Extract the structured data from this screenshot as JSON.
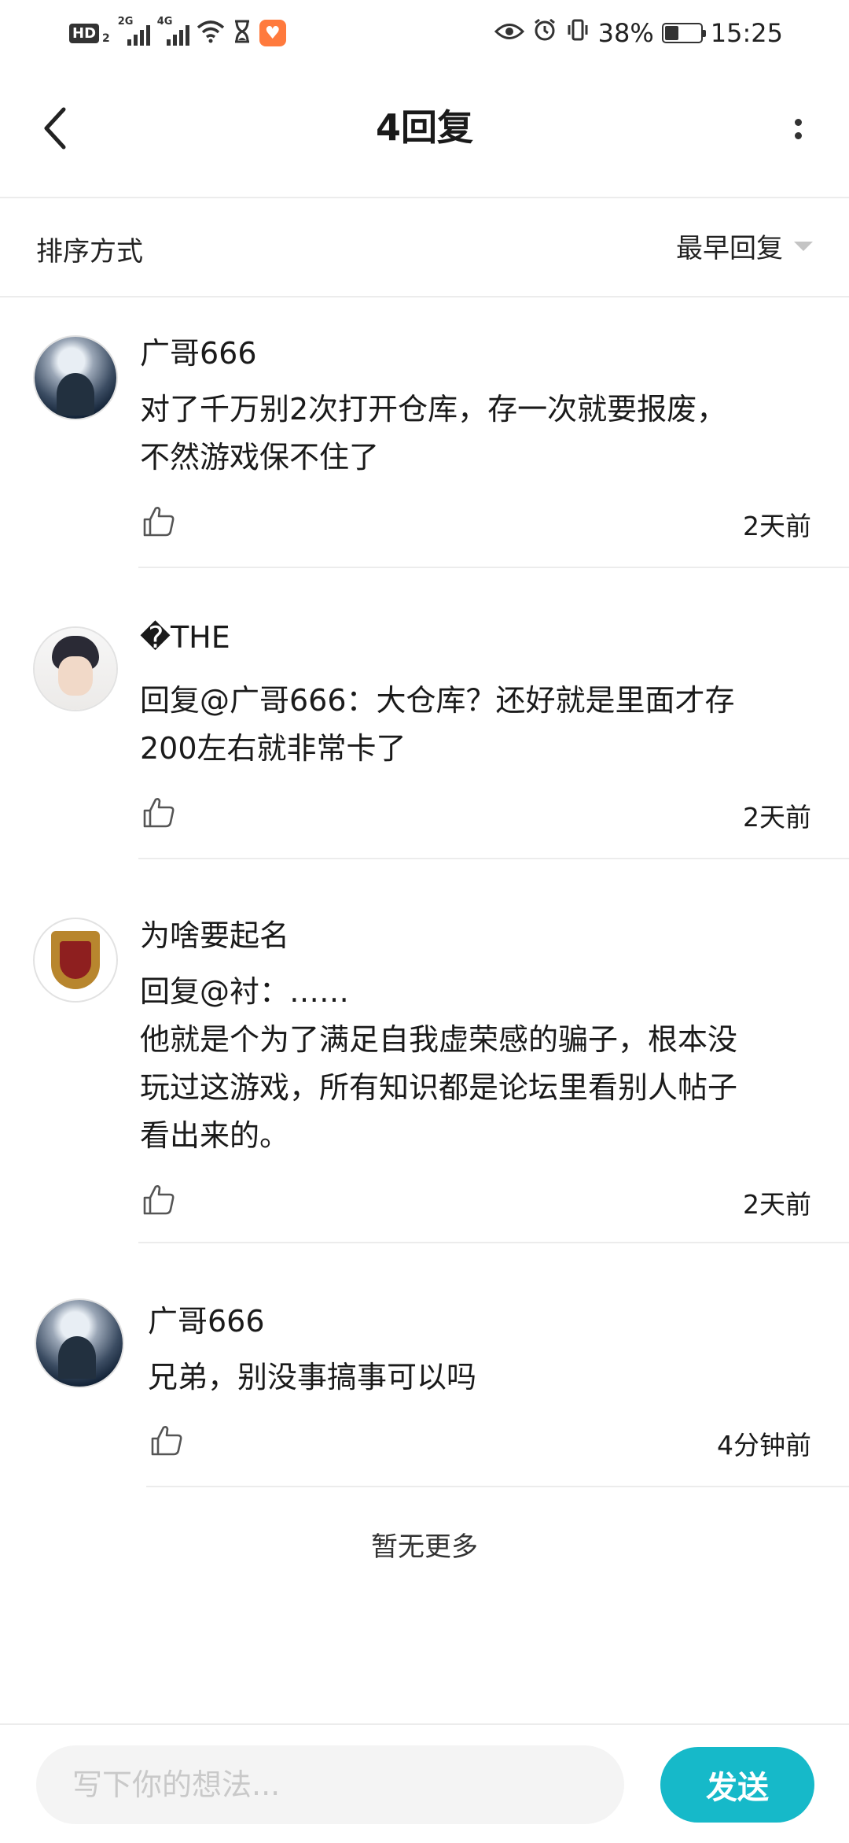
{
  "status_bar": {
    "hd_label": "HD",
    "hd_sub": "2",
    "net1_label": "2G",
    "net2_label": "4G",
    "battery_percent": "38%",
    "battery_level": 0.38,
    "time": "15:25"
  },
  "header": {
    "title": "4回复"
  },
  "sort": {
    "label": "排序方式",
    "selected": "最早回复"
  },
  "comments": [
    {
      "username": "广哥666",
      "text": "对了千万别2次打开仓库，存一次就要报废，\n不然游戏保不住了",
      "time": "2天前",
      "avatar": "anime-silver-hair-avatar"
    },
    {
      "username": "�THE",
      "text": "回复@广哥666：大仓库？还好就是里面才存\n200左右就非常卡了",
      "time": "2天前",
      "avatar": "anime-dark-hair-avatar"
    },
    {
      "username": "为啥要起名",
      "text": "回复@衬：……\n他就是个为了满足自我虚荣感的骗子，根本没\n玩过这游戏，所有知识都是论坛里看别人帖子\n看出来的。",
      "time": "2天前",
      "avatar": "crest-avatar"
    },
    {
      "username": "广哥666",
      "text": "兄弟，别没事搞事可以吗",
      "time": "4分钟前",
      "avatar": "anime-silver-hair-avatar"
    }
  ],
  "footer_note": "暂无更多",
  "composer": {
    "placeholder": "写下你的想法...",
    "send_label": "发送"
  },
  "colors": {
    "accent": "#16b9c9",
    "divider": "#ececec"
  }
}
